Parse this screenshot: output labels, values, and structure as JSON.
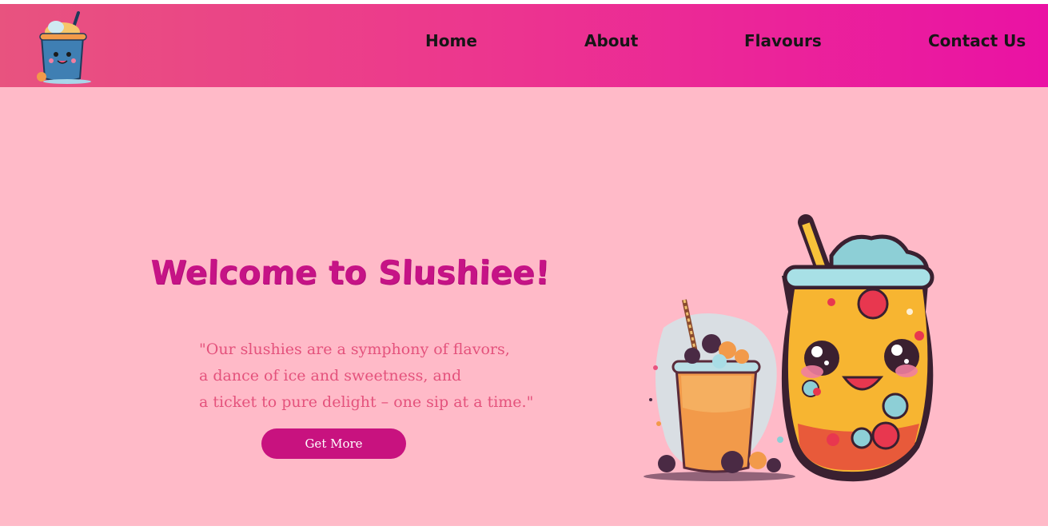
{
  "nav": {
    "links": [
      "Home",
      "About",
      "Flavours",
      "Contact Us"
    ]
  },
  "logo": {
    "icon": "slushie-mascot-logo"
  },
  "hero": {
    "title": "Welcome to Slushiee!",
    "quote_lines": [
      "\"Our slushies are a symphony of flavors,",
      "a dance of ice and sweetness, and",
      "a ticket to pure delight – one sip at a time.\""
    ],
    "cta_label": "Get More"
  },
  "colors": {
    "background": "#ffbac8",
    "nav_gradient_start": "#e8537f",
    "nav_gradient_end": "#ea12a4",
    "title": "#c61386",
    "quote": "#e4527c",
    "button": "#c8127f"
  }
}
